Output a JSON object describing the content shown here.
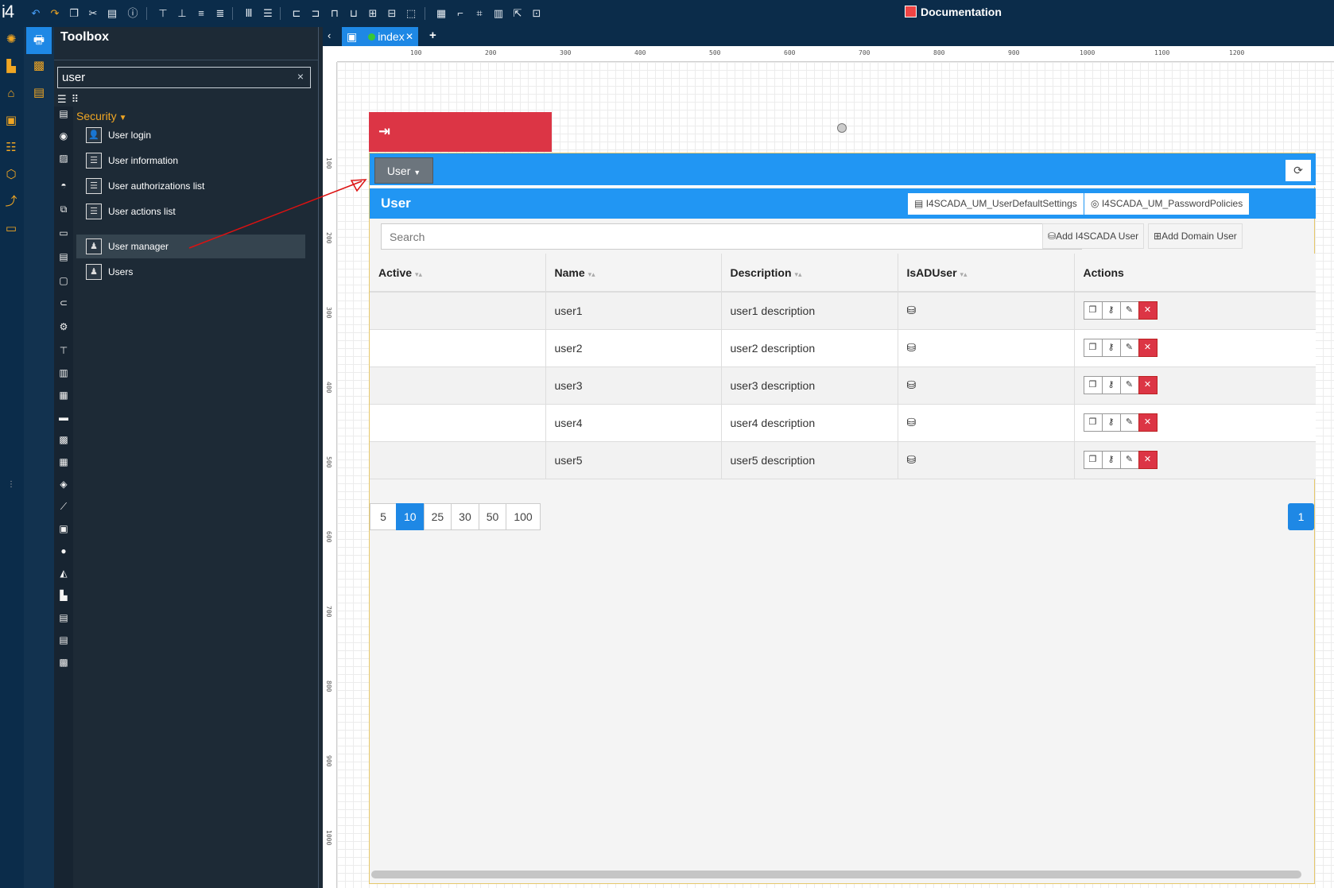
{
  "app": {
    "logo": "i4",
    "documentation_label": "Documentation"
  },
  "toolbox": {
    "title": "Toolbox",
    "search_value": "user",
    "clear_label": "×",
    "section": "Security",
    "items": [
      {
        "label": "User login"
      },
      {
        "label": "User information"
      },
      {
        "label": "User authorizations list"
      },
      {
        "label": "User actions list"
      },
      {
        "label": "User manager"
      },
      {
        "label": "Users"
      }
    ]
  },
  "editor": {
    "tab_label": "index",
    "ruler_top": [
      "100",
      "200",
      "300",
      "400",
      "500",
      "600",
      "700",
      "800",
      "900",
      "1000",
      "1100",
      "1200"
    ],
    "ruler_left": [
      "100",
      "200",
      "300",
      "400",
      "500",
      "600",
      "700",
      "800",
      "900",
      "1000"
    ]
  },
  "user_manager": {
    "user_button": "User",
    "title": "User",
    "settings_button": "I4SCADA_UM_UserDefaultSettings",
    "policies_button": "I4SCADA_UM_PasswordPolicies",
    "search_placeholder": "Search",
    "add_scada_user": "Add I4SCADA User",
    "add_domain_user": "Add Domain User",
    "columns": [
      "Active",
      "Name",
      "Description",
      "IsADUser",
      "Actions"
    ],
    "rows": [
      {
        "name": "user1",
        "description": "user1 description"
      },
      {
        "name": "user2",
        "description": "user2 description"
      },
      {
        "name": "user3",
        "description": "user3 description"
      },
      {
        "name": "user4",
        "description": "user4 description"
      },
      {
        "name": "user5",
        "description": "user5 description"
      }
    ],
    "page_sizes": [
      "5",
      "10",
      "25",
      "30",
      "50",
      "100"
    ],
    "selected_page_size": "10",
    "current_page": "1"
  },
  "colors": {
    "accent": "#2196f3",
    "danger": "#dc3545",
    "orange": "#f0a623",
    "navy": "#0b2c4a"
  }
}
